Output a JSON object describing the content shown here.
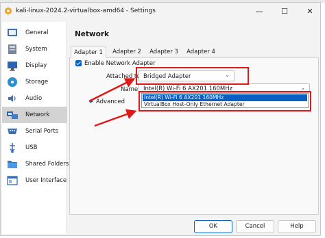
{
  "window": {
    "title": "kali-linux-2024.2-virtualbox-amd64 - Settings",
    "controls": {
      "minimize": "—",
      "maximize": "☐",
      "close": "✕"
    }
  },
  "sidebar": {
    "items": [
      {
        "label": "General",
        "icon": "general-icon"
      },
      {
        "label": "System",
        "icon": "system-icon"
      },
      {
        "label": "Display",
        "icon": "display-icon"
      },
      {
        "label": "Storage",
        "icon": "storage-icon"
      },
      {
        "label": "Audio",
        "icon": "audio-icon"
      },
      {
        "label": "Network",
        "icon": "network-icon",
        "selected": true
      },
      {
        "label": "Serial Ports",
        "icon": "serial-ports-icon"
      },
      {
        "label": "USB",
        "icon": "usb-icon"
      },
      {
        "label": "Shared Folders",
        "icon": "shared-folders-icon"
      },
      {
        "label": "User Interface",
        "icon": "user-interface-icon"
      }
    ]
  },
  "main": {
    "section_title": "Network",
    "tabs": [
      {
        "label": "Adapter 1",
        "active": true
      },
      {
        "label": "Adapter 2"
      },
      {
        "label": "Adapter 3"
      },
      {
        "label": "Adapter 4"
      }
    ],
    "enable_adapter": {
      "label": "Enable Network Adapter",
      "checked": true
    },
    "attached_to": {
      "label": "Attached to:",
      "value": "Bridged Adapter"
    },
    "name": {
      "label": "Name:",
      "value": "Intel(R) Wi-Fi 6 AX201 160MHz"
    },
    "advanced": {
      "label": "Advanced"
    },
    "name_dropdown": {
      "options": [
        "Intel(R) Wi-Fi 6 AX201 160MHz",
        "VirtualBox Host-Only Ethernet Adapter"
      ],
      "selected_index": 0
    }
  },
  "buttons": {
    "ok": "OK",
    "cancel": "Cancel",
    "help": "Help"
  },
  "annotation": {
    "color": "#e01818"
  },
  "colors": {
    "accent": "#0a5fc2",
    "selection": "#d3d3d3"
  }
}
